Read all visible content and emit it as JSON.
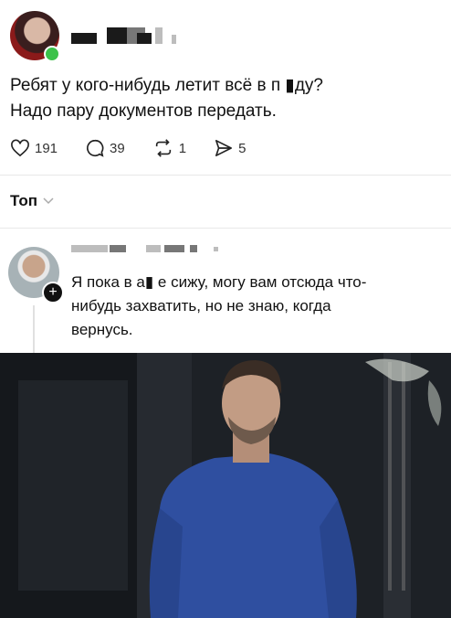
{
  "post": {
    "text_line1": "Ребят у кого-нибудь летит всё в п ▮ду?",
    "text_line2": "Надо пару документов передать."
  },
  "actions": {
    "likes": "191",
    "replies": "39",
    "reposts": "1",
    "shares": "5"
  },
  "sort": {
    "label": "Топ"
  },
  "reply": {
    "line1": "Я пока в а▮  е сижу, могу вам отсюда что-",
    "line2": "нибудь захватить, но не знаю, когда",
    "line3": "вернусь."
  },
  "colors": {
    "online": "#3cc24a",
    "sweater": "#2f4fa0",
    "divider": "#e8e8e8"
  }
}
